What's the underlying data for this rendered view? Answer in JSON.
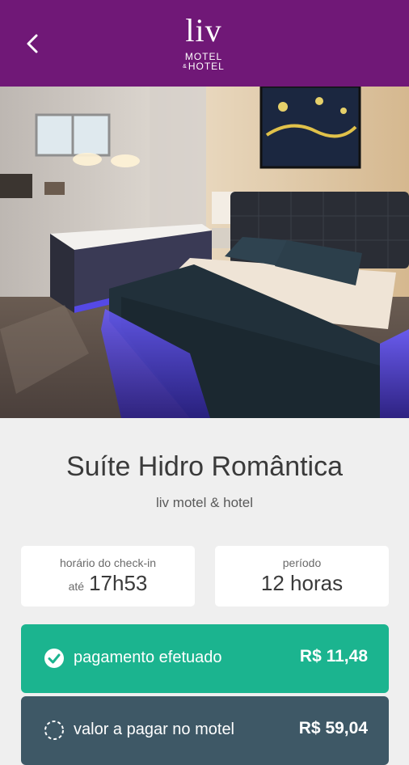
{
  "header": {
    "back_icon": "chevron-left-icon",
    "brand_colors": {
      "header_bg": "#701877"
    },
    "logo": {
      "line1": "liv",
      "line2": "MOTEL",
      "amp": "&",
      "line3": "HOTEL"
    }
  },
  "room": {
    "name": "Suíte Hidro Romântica",
    "venue": "liv motel & hotel"
  },
  "info_cards": {
    "checkin": {
      "label": "horário do check-in",
      "prefix": "até",
      "value": "17h53"
    },
    "period": {
      "label": "período",
      "value": "12 horas"
    }
  },
  "payment": {
    "paid": {
      "label": "pagamento efetuado",
      "amount": "R$ 11,48",
      "icon": "check-circle-icon",
      "color": "#1bb48f"
    },
    "due": {
      "label": "valor a pagar no motel",
      "amount": "R$ 59,04",
      "icon": "dashed-circle-icon",
      "color": "#3e5866"
    }
  }
}
